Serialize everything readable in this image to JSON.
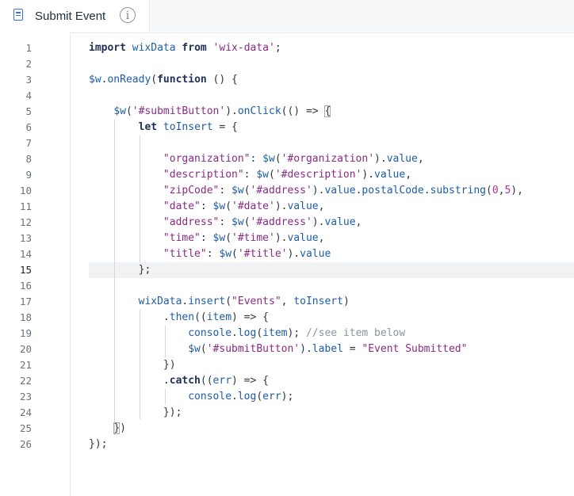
{
  "tab": {
    "title": "Submit Event",
    "info_icon": "i"
  },
  "editor": {
    "active_line": 15,
    "lines": [
      [
        {
          "t": "import",
          "k": "keyword"
        },
        {
          "t": " wixData ",
          "k": "ident"
        },
        {
          "t": "from",
          "k": "keyword"
        },
        {
          "t": " 'wix-data'",
          "k": "string"
        },
        {
          "t": ";",
          "k": "punct"
        }
      ],
      [],
      [
        {
          "t": "$w",
          "k": "ident"
        },
        {
          "t": ".",
          "k": "punct"
        },
        {
          "t": "onReady",
          "k": "ident"
        },
        {
          "t": "(",
          "k": "punct"
        },
        {
          "t": "function",
          "k": "keyword"
        },
        {
          "t": " () {",
          "k": "punct"
        }
      ],
      [],
      [
        {
          "t": "    ",
          "k": "punct"
        },
        {
          "t": "$w",
          "k": "ident"
        },
        {
          "t": "(",
          "k": "punct"
        },
        {
          "t": "'#submitButton'",
          "k": "string"
        },
        {
          "t": ").",
          "k": "punct"
        },
        {
          "t": "onClick",
          "k": "ident"
        },
        {
          "t": "(() => ",
          "k": "punct"
        },
        {
          "t": "{",
          "k": "bracket"
        }
      ],
      [
        {
          "t": "        ",
          "k": "punct"
        },
        {
          "t": "let",
          "k": "keyword"
        },
        {
          "t": " toInsert",
          "k": "ident"
        },
        {
          "t": " = {",
          "k": "punct"
        }
      ],
      [],
      [
        {
          "t": "            ",
          "k": "punct"
        },
        {
          "t": "\"organization\"",
          "k": "string"
        },
        {
          "t": ": ",
          "k": "punct"
        },
        {
          "t": "$w",
          "k": "ident"
        },
        {
          "t": "(",
          "k": "punct"
        },
        {
          "t": "'#organization'",
          "k": "string"
        },
        {
          "t": ").",
          "k": "punct"
        },
        {
          "t": "value",
          "k": "ident"
        },
        {
          "t": ",",
          "k": "punct"
        }
      ],
      [
        {
          "t": "            ",
          "k": "punct"
        },
        {
          "t": "\"description\"",
          "k": "string"
        },
        {
          "t": ": ",
          "k": "punct"
        },
        {
          "t": "$w",
          "k": "ident"
        },
        {
          "t": "(",
          "k": "punct"
        },
        {
          "t": "'#description'",
          "k": "string"
        },
        {
          "t": ").",
          "k": "punct"
        },
        {
          "t": "value",
          "k": "ident"
        },
        {
          "t": ",",
          "k": "punct"
        }
      ],
      [
        {
          "t": "            ",
          "k": "punct"
        },
        {
          "t": "\"zipCode\"",
          "k": "string"
        },
        {
          "t": ": ",
          "k": "punct"
        },
        {
          "t": "$w",
          "k": "ident"
        },
        {
          "t": "(",
          "k": "punct"
        },
        {
          "t": "'#address'",
          "k": "string"
        },
        {
          "t": ").",
          "k": "punct"
        },
        {
          "t": "value",
          "k": "ident"
        },
        {
          "t": ".",
          "k": "punct"
        },
        {
          "t": "postalCode",
          "k": "ident"
        },
        {
          "t": ".",
          "k": "punct"
        },
        {
          "t": "substring",
          "k": "ident"
        },
        {
          "t": "(",
          "k": "punct"
        },
        {
          "t": "0",
          "k": "number"
        },
        {
          "t": ",",
          "k": "punct"
        },
        {
          "t": "5",
          "k": "number"
        },
        {
          "t": "),",
          "k": "punct"
        }
      ],
      [
        {
          "t": "            ",
          "k": "punct"
        },
        {
          "t": "\"date\"",
          "k": "string"
        },
        {
          "t": ": ",
          "k": "punct"
        },
        {
          "t": "$w",
          "k": "ident"
        },
        {
          "t": "(",
          "k": "punct"
        },
        {
          "t": "'#date'",
          "k": "string"
        },
        {
          "t": ").",
          "k": "punct"
        },
        {
          "t": "value",
          "k": "ident"
        },
        {
          "t": ",",
          "k": "punct"
        }
      ],
      [
        {
          "t": "            ",
          "k": "punct"
        },
        {
          "t": "\"address\"",
          "k": "string"
        },
        {
          "t": ": ",
          "k": "punct"
        },
        {
          "t": "$w",
          "k": "ident"
        },
        {
          "t": "(",
          "k": "punct"
        },
        {
          "t": "'#address'",
          "k": "string"
        },
        {
          "t": ").",
          "k": "punct"
        },
        {
          "t": "value",
          "k": "ident"
        },
        {
          "t": ",",
          "k": "punct"
        }
      ],
      [
        {
          "t": "            ",
          "k": "punct"
        },
        {
          "t": "\"time\"",
          "k": "string"
        },
        {
          "t": ": ",
          "k": "punct"
        },
        {
          "t": "$w",
          "k": "ident"
        },
        {
          "t": "(",
          "k": "punct"
        },
        {
          "t": "'#time'",
          "k": "string"
        },
        {
          "t": ").",
          "k": "punct"
        },
        {
          "t": "value",
          "k": "ident"
        },
        {
          "t": ",",
          "k": "punct"
        }
      ],
      [
        {
          "t": "            ",
          "k": "punct"
        },
        {
          "t": "\"title\"",
          "k": "string"
        },
        {
          "t": ": ",
          "k": "punct"
        },
        {
          "t": "$w",
          "k": "ident"
        },
        {
          "t": "(",
          "k": "punct"
        },
        {
          "t": "'#title'",
          "k": "string"
        },
        {
          "t": ").",
          "k": "punct"
        },
        {
          "t": "value",
          "k": "ident"
        }
      ],
      [
        {
          "t": "        };",
          "k": "punct"
        }
      ],
      [],
      [
        {
          "t": "        ",
          "k": "punct"
        },
        {
          "t": "wixData",
          "k": "ident"
        },
        {
          "t": ".",
          "k": "punct"
        },
        {
          "t": "insert",
          "k": "ident"
        },
        {
          "t": "(",
          "k": "punct"
        },
        {
          "t": "\"Events\"",
          "k": "string"
        },
        {
          "t": ", ",
          "k": "punct"
        },
        {
          "t": "toInsert",
          "k": "ident"
        },
        {
          "t": ")",
          "k": "punct"
        }
      ],
      [
        {
          "t": "            .",
          "k": "punct"
        },
        {
          "t": "then",
          "k": "ident"
        },
        {
          "t": "((",
          "k": "punct"
        },
        {
          "t": "item",
          "k": "ident"
        },
        {
          "t": ") => {",
          "k": "punct"
        }
      ],
      [
        {
          "t": "                ",
          "k": "punct"
        },
        {
          "t": "console",
          "k": "ident"
        },
        {
          "t": ".",
          "k": "punct"
        },
        {
          "t": "log",
          "k": "ident"
        },
        {
          "t": "(",
          "k": "punct"
        },
        {
          "t": "item",
          "k": "ident"
        },
        {
          "t": "); ",
          "k": "punct"
        },
        {
          "t": "//see item below",
          "k": "comment"
        }
      ],
      [
        {
          "t": "                ",
          "k": "punct"
        },
        {
          "t": "$w",
          "k": "ident"
        },
        {
          "t": "(",
          "k": "punct"
        },
        {
          "t": "'#submitButton'",
          "k": "string"
        },
        {
          "t": ").",
          "k": "punct"
        },
        {
          "t": "label",
          "k": "ident"
        },
        {
          "t": " = ",
          "k": "punct"
        },
        {
          "t": "\"Event Submitted\"",
          "k": "string"
        }
      ],
      [
        {
          "t": "            })",
          "k": "punct"
        }
      ],
      [
        {
          "t": "            .",
          "k": "punct"
        },
        {
          "t": "catch",
          "k": "keyword"
        },
        {
          "t": "((",
          "k": "punct"
        },
        {
          "t": "err",
          "k": "ident"
        },
        {
          "t": ") => {",
          "k": "punct"
        }
      ],
      [
        {
          "t": "                ",
          "k": "punct"
        },
        {
          "t": "console",
          "k": "ident"
        },
        {
          "t": ".",
          "k": "punct"
        },
        {
          "t": "log",
          "k": "ident"
        },
        {
          "t": "(",
          "k": "punct"
        },
        {
          "t": "err",
          "k": "ident"
        },
        {
          "t": ");",
          "k": "punct"
        }
      ],
      [
        {
          "t": "            });",
          "k": "punct"
        }
      ],
      [
        {
          "t": "    ",
          "k": "punct"
        },
        {
          "t": "}",
          "k": "bracket"
        },
        {
          "t": ")",
          "k": "punct"
        }
      ],
      [
        {
          "t": "});",
          "k": "punct"
        }
      ]
    ]
  }
}
